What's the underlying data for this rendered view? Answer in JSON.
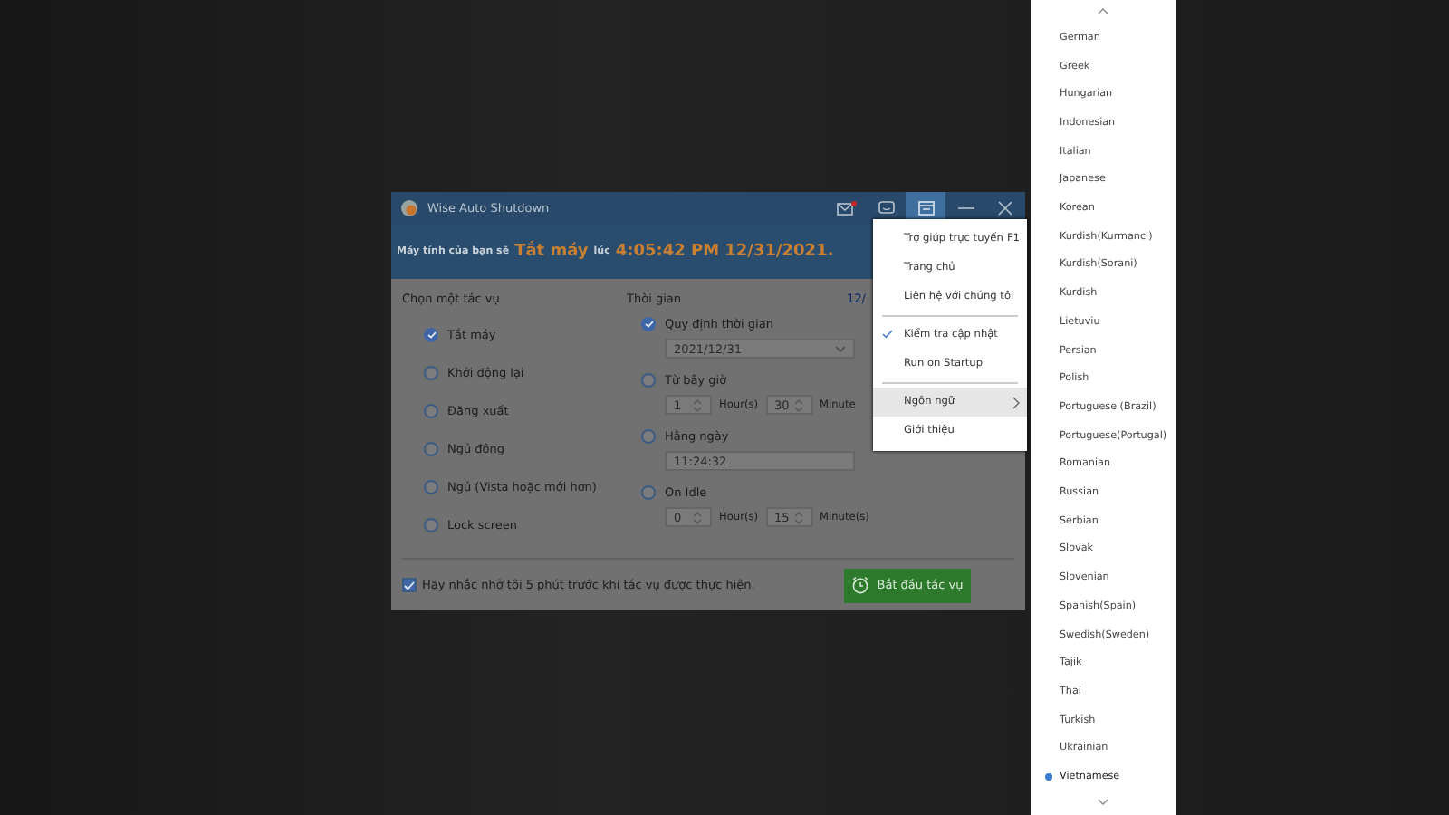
{
  "window": {
    "title": "Wise Auto Shutdown"
  },
  "banner": {
    "prefix": "Máy tính của bạn sẽ",
    "action": "Tắt máy",
    "middle": "lúc",
    "time": "4:05:42 PM 12/31/2021",
    "end": "."
  },
  "tasks": {
    "heading": "Chọn một tác vụ",
    "options": [
      {
        "label": "Tắt máy",
        "selected": true
      },
      {
        "label": "Khởi động lại",
        "selected": false
      },
      {
        "label": "Đăng xuất",
        "selected": false
      },
      {
        "label": "Ngủ đông",
        "selected": false
      },
      {
        "label": "Ngủ (Vista hoặc mới hơn)",
        "selected": false
      },
      {
        "label": "Lock screen",
        "selected": false
      }
    ]
  },
  "time": {
    "heading": "Thời gian",
    "current": "12/",
    "modes": [
      {
        "kind": "date",
        "label": "Quy định thời gian",
        "selected": true,
        "value": "2021/12/31"
      },
      {
        "kind": "duration",
        "label": "Từ bây giờ",
        "selected": false,
        "hours": "1",
        "hours_unit": "Hour(s)",
        "minutes": "30",
        "minutes_unit": "Minute"
      },
      {
        "kind": "clock",
        "label": "Hằng ngày",
        "selected": false,
        "value": "11:24:32"
      },
      {
        "kind": "duration",
        "label": "On Idle",
        "selected": false,
        "hours": "0",
        "hours_unit": "Hour(s)",
        "minutes": "15",
        "minutes_unit": "Minute(s)"
      }
    ]
  },
  "reminder": {
    "label": "Hãy nhắc nhở tôi 5 phút trước khi tác vụ được thực hiện.",
    "checked": true
  },
  "start_button": "Bắt đầu tác vụ",
  "menu": [
    {
      "kind": "item",
      "label": "Trợ giúp trực tuyến",
      "shortcut": "F1",
      "checked": false,
      "selected": false
    },
    {
      "kind": "item",
      "label": "Trang chủ",
      "checked": false,
      "selected": false
    },
    {
      "kind": "item",
      "label": "Liên hệ với chúng tôi",
      "checked": false,
      "selected": false
    },
    {
      "kind": "separator"
    },
    {
      "kind": "item",
      "label": "Kiểm tra cập nhật",
      "checked": true,
      "selected": false
    },
    {
      "kind": "item",
      "label": "Run on Startup",
      "checked": false,
      "selected": false
    },
    {
      "kind": "separator"
    },
    {
      "kind": "submenu",
      "label": "Ngôn ngữ",
      "checked": false,
      "selected": true
    },
    {
      "kind": "item",
      "label": "Giới thiệu",
      "checked": false,
      "selected": false
    }
  ],
  "languages": [
    {
      "label": "German",
      "selected": false
    },
    {
      "label": "Greek",
      "selected": false
    },
    {
      "label": "Hungarian",
      "selected": false
    },
    {
      "label": "Indonesian",
      "selected": false
    },
    {
      "label": "Italian",
      "selected": false
    },
    {
      "label": "Japanese",
      "selected": false
    },
    {
      "label": "Korean",
      "selected": false
    },
    {
      "label": "Kurdish(Kurmanci)",
      "selected": false
    },
    {
      "label": "Kurdish(Sorani)",
      "selected": false
    },
    {
      "label": "Kurdish",
      "selected": false
    },
    {
      "label": "Lietuviu",
      "selected": false
    },
    {
      "label": "Persian",
      "selected": false
    },
    {
      "label": "Polish",
      "selected": false
    },
    {
      "label": "Portuguese (Brazil)",
      "selected": false
    },
    {
      "label": "Portuguese(Portugal)",
      "selected": false
    },
    {
      "label": "Romanian",
      "selected": false
    },
    {
      "label": "Russian",
      "selected": false
    },
    {
      "label": "Serbian",
      "selected": false
    },
    {
      "label": "Slovak",
      "selected": false
    },
    {
      "label": "Slovenian",
      "selected": false
    },
    {
      "label": "Spanish(Spain)",
      "selected": false
    },
    {
      "label": "Swedish(Sweden)",
      "selected": false
    },
    {
      "label": "Tajik",
      "selected": false
    },
    {
      "label": "Thai",
      "selected": false
    },
    {
      "label": "Turkish",
      "selected": false
    },
    {
      "label": "Ukrainian",
      "selected": false
    },
    {
      "label": "Vietnamese",
      "selected": true
    }
  ]
}
